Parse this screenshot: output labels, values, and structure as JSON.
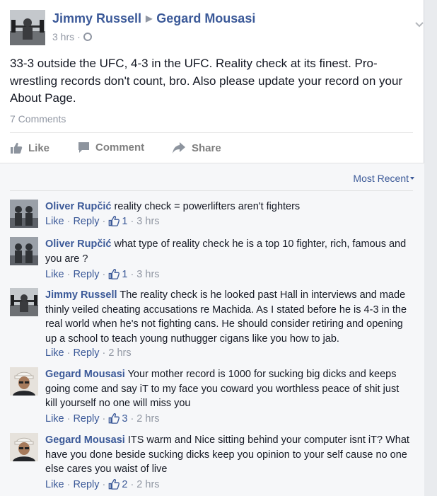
{
  "post": {
    "author": "Jimmy Russell",
    "target": "Gegard Mousasi",
    "time": "3 hrs",
    "privacy_icon": "globe-icon",
    "text": "33-3 outside the UFC, 4-3 in the UFC. Reality check at its finest. Pro-wrestling records don't count, bro. Also please update your record on your About Page.",
    "comment_count": "7 Comments"
  },
  "actions": {
    "like": "Like",
    "comment": "Comment",
    "share": "Share"
  },
  "sort": {
    "label": "Most Recent"
  },
  "comments": [
    {
      "author": "Oliver Rupčić",
      "text": "reality check = powerlifters aren't fighters",
      "like": "Like",
      "reply": "Reply",
      "likes": "1",
      "time": "3 hrs"
    },
    {
      "author": "Oliver Rupčić",
      "text": "what type of reality check he is a top 10 fighter, rich, famous and you are ?",
      "like": "Like",
      "reply": "Reply",
      "likes": "1",
      "time": "3 hrs"
    },
    {
      "author": "Jimmy Russell",
      "text": "The reality check is he looked past Hall in interviews and made thinly veiled cheating accusations re Machida. As I stated before he is 4-3 in the real world when he's not fighting cans. He should consider retiring and opening up a school to teach young nuthugger cigans like you how to jab.",
      "like": "Like",
      "reply": "Reply",
      "likes": "",
      "time": "2 hrs"
    },
    {
      "author": "Gegard Mousasi",
      "text": "Your mother record is 1000 for sucking big dicks and keeps going come and say iT to my face you coward you worthless peace of shit just kill yourself no one will miss you",
      "like": "Like",
      "reply": "Reply",
      "likes": "3",
      "time": "2 hrs"
    },
    {
      "author": "Gegard Mousasi",
      "text": "ITS warm and Nice sitting behind your computer isnt iT? What have you done beside sucking dicks keep you opinion to your self cause no one else cares you waist of live",
      "like": "Like",
      "reply": "Reply",
      "likes": "2",
      "time": "2 hrs"
    }
  ],
  "colors": {
    "link": "#3b5998",
    "muted": "#9197a3",
    "comments_bg": "#f6f7f9"
  }
}
